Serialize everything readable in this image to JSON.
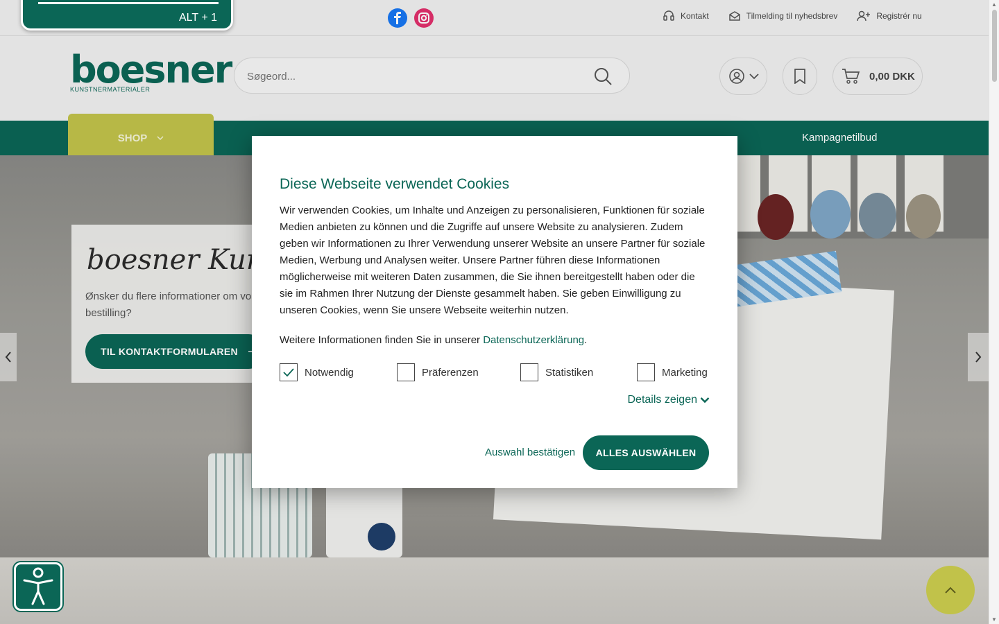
{
  "skip_hint": "ALT + 1",
  "topbar": {
    "links": [
      {
        "label": "Kontakt",
        "icon": "headset-icon"
      },
      {
        "label": "Tilmelding til nyhedsbrev",
        "icon": "envelope-icon"
      },
      {
        "label": "Registrér nu",
        "icon": "user-plus-icon"
      }
    ],
    "social": [
      "facebook-icon",
      "instagram-icon"
    ]
  },
  "header": {
    "logo_word": "boesner",
    "logo_sub": "KUNSTNERMATERIALER",
    "search_placeholder": "Søgeord...",
    "cart_total": "0,00 DKK"
  },
  "nav": {
    "shop_label": "SHOP",
    "items": [
      "Kampagnetilbud"
    ]
  },
  "hero": {
    "script_title": "boesner Kunde",
    "text": "Ønsker du flere informationer om vo din bestilling?",
    "cta": "TIL KONTAKTFORMULAREN"
  },
  "cookie_modal": {
    "title": "Diese Webseite verwendet Cookies",
    "body": "Wir verwenden Cookies, um Inhalte und Anzeigen zu personalisieren, Funktionen für soziale Medien anbieten zu können und die Zugriffe auf unsere Website zu analysieren. Zudem geben wir Informationen zu Ihrer Verwendung unserer Website an unsere Partner für soziale Medien, Werbung und Analysen weiter. Unsere Partner führen diese Informationen möglicherweise mit weiteren Daten zusammen, die Sie ihnen bereitgestellt haben oder die sie im Rahmen Ihrer Nutzung der Dienste gesammelt haben. Sie geben Einwilligung zu unseren Cookies, wenn Sie unsere Webseite weiterhin nutzen.",
    "more_prefix": "Weitere Informationen finden Sie in unserer ",
    "more_link": "Datenschutzerklärung",
    "more_suffix": ".",
    "checkboxes": [
      {
        "label": "Notwendig",
        "checked": true
      },
      {
        "label": "Präferenzen",
        "checked": false
      },
      {
        "label": "Statistiken",
        "checked": false
      },
      {
        "label": "Marketing",
        "checked": false
      }
    ],
    "details_label": "Details zeigen",
    "confirm_label": "Auswahl bestätigen",
    "select_all_label": "ALLES AUSWÄHLEN"
  },
  "colors": {
    "brand_green": "#0b6656",
    "accent_olive": "#c1c24a"
  }
}
